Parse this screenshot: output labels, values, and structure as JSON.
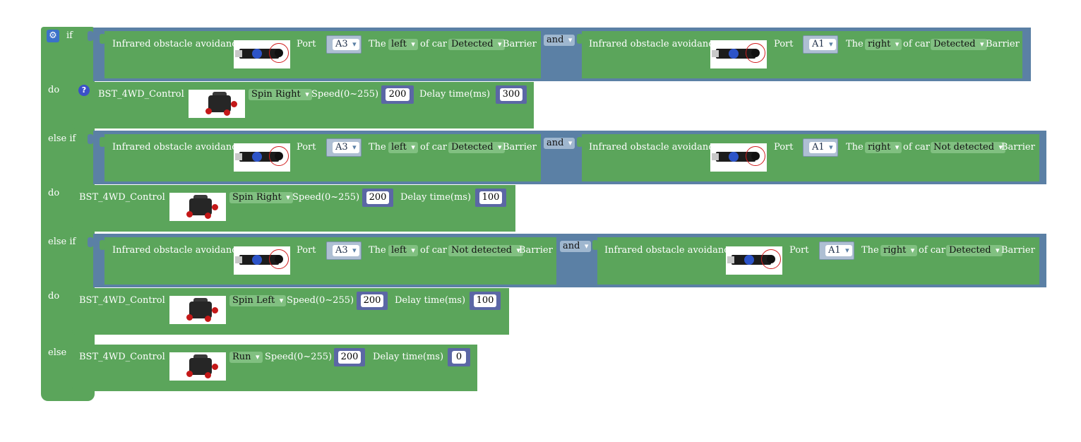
{
  "if_block": {
    "if_label": "if",
    "do_label": "do",
    "else_if_label": "else if",
    "else_label": "else",
    "gear_icon": "gear-icon",
    "help_icon": "?"
  },
  "colors": {
    "logic_blue": "#5b80a5",
    "block_green": "#5ba55b",
    "number_block": "#5b67a5",
    "gear_blue": "#3b71c9"
  },
  "sensor": {
    "label": "Infrared obstacle avoidance",
    "port_label": "Port",
    "the_label": "The",
    "of_car_label": "of car",
    "barrier_label": "Barrier"
  },
  "operator": "and",
  "conditions": [
    {
      "left": {
        "port": "A3",
        "side": "left",
        "state": "Detected"
      },
      "right": {
        "port": "A1",
        "side": "right",
        "state": "Detected"
      }
    },
    {
      "left": {
        "port": "A3",
        "side": "left",
        "state": "Detected"
      },
      "right": {
        "port": "A1",
        "side": "right",
        "state": "Not detected"
      }
    },
    {
      "left": {
        "port": "A3",
        "side": "left",
        "state": "Not detected"
      },
      "right": {
        "port": "A1",
        "side": "right",
        "state": "Detected"
      }
    }
  ],
  "control": {
    "label": "BST_4WD_Control",
    "speed_label": "Speed(0~255)",
    "delay_label": "Delay time(ms)"
  },
  "actions": [
    {
      "mode": "Spin Right",
      "speed": "200",
      "delay": "300"
    },
    {
      "mode": "Spin Right",
      "speed": "200",
      "delay": "100"
    },
    {
      "mode": "Spin Left",
      "speed": "200",
      "delay": "100"
    },
    {
      "mode": "Run",
      "speed": "200",
      "delay": "0"
    }
  ]
}
